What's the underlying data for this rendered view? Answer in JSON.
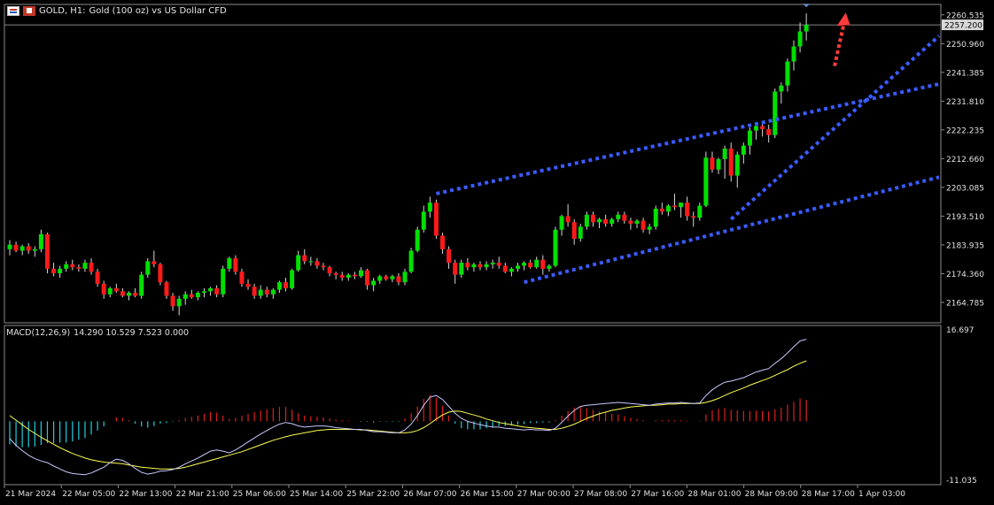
{
  "header": {
    "symbol_label": "GOLD, H1:",
    "description": "Gold (100 oz) vs US Dollar CFD",
    "icons": [
      "chart-grid-icon",
      "flag-icon"
    ]
  },
  "macd": {
    "label": "MACD(12,26,9)",
    "values_text": "14.290 10.529 7.523 0.000",
    "axis_top": "16.697",
    "axis_bottom": "-11.035"
  },
  "colors": {
    "background": "#000000",
    "bull": "#00e000",
    "bear": "#ff1a1a",
    "trend": "#3b5bff",
    "arrow": "#ff3b3b",
    "macd_line": "#c8c8ff",
    "signal_line": "#ffff55",
    "hist_pos": "#e02020",
    "hist_neg": "#20d0e0",
    "price_tag_bg": "#d8d8d8"
  },
  "chart_data": [
    {
      "type": "candlestick",
      "title": "GOLD, H1: Gold (100 oz) vs US Dollar CFD",
      "ylim": [
        2158,
        2264
      ],
      "y_ticks": [
        "2260.535",
        "2250.960",
        "2241.385",
        "2231.810",
        "2222.235",
        "2212.660",
        "2203.085",
        "2193.510",
        "2183.935",
        "2174.360",
        "2164.785"
      ],
      "current_price": "2257.200",
      "x_ticks": [
        "21 Mar 2024",
        "22 Mar 05:00",
        "22 Mar 13:00",
        "22 Mar 21:00",
        "25 Mar 06:00",
        "25 Mar 14:00",
        "25 Mar 22:00",
        "26 Mar 07:00",
        "26 Mar 15:00",
        "27 Mar 00:00",
        "27 Mar 08:00",
        "27 Mar 16:00",
        "28 Mar 01:00",
        "28 Mar 09:00",
        "28 Mar 17:00",
        "1 Apr 03:00"
      ],
      "candles": [
        [
          2182.5,
          2185.5,
          2180.5,
          2184.0
        ],
        [
          2184.0,
          2185.0,
          2181.5,
          2182.0
        ],
        [
          2182.0,
          2184.0,
          2180.5,
          2183.5
        ],
        [
          2183.5,
          2184.5,
          2181.0,
          2182.0
        ],
        [
          2182.0,
          2183.5,
          2180.0,
          2182.5
        ],
        [
          2182.5,
          2189.0,
          2181.5,
          2187.5
        ],
        [
          2187.5,
          2188.0,
          2174.5,
          2176.0
        ],
        [
          2176.0,
          2178.0,
          2173.5,
          2174.5
        ],
        [
          2174.5,
          2177.0,
          2173.0,
          2176.0
        ],
        [
          2176.0,
          2178.5,
          2175.0,
          2177.5
        ],
        [
          2177.5,
          2179.0,
          2175.5,
          2176.5
        ],
        [
          2176.5,
          2177.5,
          2175.0,
          2176.0
        ],
        [
          2176.0,
          2179.0,
          2175.0,
          2178.0
        ],
        [
          2178.0,
          2179.5,
          2174.0,
          2175.0
        ],
        [
          2175.0,
          2176.0,
          2170.0,
          2171.0
        ],
        [
          2171.0,
          2172.0,
          2166.0,
          2167.5
        ],
        [
          2167.5,
          2170.0,
          2166.5,
          2169.5
        ],
        [
          2169.5,
          2171.0,
          2168.0,
          2168.5
        ],
        [
          2168.5,
          2169.5,
          2166.5,
          2167.0
        ],
        [
          2167.0,
          2168.5,
          2165.5,
          2168.0
        ],
        [
          2168.0,
          2169.5,
          2166.5,
          2167.0
        ],
        [
          2167.0,
          2175.0,
          2166.0,
          2174.0
        ],
        [
          2174.0,
          2179.5,
          2173.0,
          2178.5
        ],
        [
          2178.5,
          2182.0,
          2176.5,
          2177.5
        ],
        [
          2177.5,
          2178.0,
          2170.5,
          2171.5
        ],
        [
          2171.5,
          2172.0,
          2166.0,
          2167.0
        ],
        [
          2167.0,
          2168.0,
          2162.0,
          2163.5
        ],
        [
          2163.5,
          2167.0,
          2160.5,
          2166.0
        ],
        [
          2166.0,
          2168.5,
          2164.0,
          2167.5
        ],
        [
          2167.5,
          2169.0,
          2166.0,
          2166.5
        ],
        [
          2166.5,
          2168.5,
          2165.5,
          2168.0
        ],
        [
          2168.0,
          2169.5,
          2166.5,
          2168.5
        ],
        [
          2168.5,
          2170.0,
          2167.0,
          2169.5
        ],
        [
          2169.5,
          2170.5,
          2166.5,
          2167.5
        ],
        [
          2167.5,
          2177.0,
          2166.5,
          2176.0
        ],
        [
          2176.0,
          2180.0,
          2175.0,
          2179.5
        ],
        [
          2179.5,
          2180.5,
          2174.0,
          2175.0
        ],
        [
          2175.0,
          2176.0,
          2170.0,
          2171.0
        ],
        [
          2171.0,
          2172.5,
          2169.0,
          2170.0
        ],
        [
          2170.0,
          2171.0,
          2166.0,
          2167.0
        ],
        [
          2167.0,
          2170.5,
          2166.0,
          2169.0
        ],
        [
          2169.0,
          2170.0,
          2166.5,
          2167.5
        ],
        [
          2167.5,
          2169.5,
          2166.0,
          2169.0
        ],
        [
          2169.0,
          2172.0,
          2168.0,
          2171.5
        ],
        [
          2171.5,
          2173.0,
          2168.5,
          2169.5
        ],
        [
          2169.5,
          2176.0,
          2169.0,
          2175.5
        ],
        [
          2175.5,
          2182.0,
          2175.0,
          2180.5
        ],
        [
          2180.5,
          2182.5,
          2177.5,
          2178.5
        ],
        [
          2178.5,
          2180.0,
          2177.0,
          2178.5
        ],
        [
          2178.5,
          2179.5,
          2176.0,
          2177.0
        ],
        [
          2177.0,
          2178.0,
          2175.5,
          2176.5
        ],
        [
          2176.5,
          2177.0,
          2173.5,
          2174.5
        ],
        [
          2174.5,
          2175.0,
          2172.5,
          2174.0
        ],
        [
          2174.0,
          2175.0,
          2172.0,
          2173.0
        ],
        [
          2173.0,
          2174.5,
          2172.0,
          2174.0
        ],
        [
          2174.0,
          2175.0,
          2172.5,
          2173.5
        ],
        [
          2173.5,
          2176.5,
          2173.0,
          2175.5
        ],
        [
          2175.5,
          2176.0,
          2169.0,
          2170.5
        ],
        [
          2170.5,
          2173.0,
          2168.5,
          2172.0
        ],
        [
          2172.0,
          2174.0,
          2171.0,
          2173.5
        ],
        [
          2173.5,
          2174.0,
          2172.0,
          2172.5
        ],
        [
          2172.5,
          2174.0,
          2171.5,
          2173.5
        ],
        [
          2173.5,
          2174.5,
          2170.5,
          2171.5
        ],
        [
          2171.5,
          2176.0,
          2170.5,
          2175.0
        ],
        [
          2175.0,
          2183.0,
          2174.5,
          2182.0
        ],
        [
          2182.0,
          2190.0,
          2181.5,
          2189.0
        ],
        [
          2189.0,
          2197.0,
          2188.0,
          2195.0
        ],
        [
          2195.0,
          2200.0,
          2193.0,
          2198.0
        ],
        [
          2198.0,
          2199.0,
          2186.0,
          2187.0
        ],
        [
          2187.0,
          2188.0,
          2181.0,
          2182.5
        ],
        [
          2182.5,
          2183.5,
          2176.0,
          2178.0
        ],
        [
          2178.0,
          2179.0,
          2171.0,
          2174.0
        ],
        [
          2174.0,
          2179.0,
          2173.0,
          2178.0
        ],
        [
          2178.0,
          2179.5,
          2175.5,
          2176.5
        ],
        [
          2176.5,
          2178.0,
          2175.0,
          2177.5
        ],
        [
          2177.5,
          2178.5,
          2175.5,
          2176.5
        ],
        [
          2176.5,
          2178.5,
          2175.5,
          2177.5
        ],
        [
          2177.5,
          2179.0,
          2176.0,
          2178.0
        ],
        [
          2178.0,
          2180.0,
          2176.0,
          2177.0
        ],
        [
          2177.0,
          2178.0,
          2174.5,
          2175.0
        ],
        [
          2175.0,
          2176.5,
          2173.5,
          2176.0
        ],
        [
          2176.0,
          2178.0,
          2175.0,
          2177.0
        ],
        [
          2177.0,
          2178.5,
          2175.5,
          2178.0
        ],
        [
          2178.0,
          2179.0,
          2176.0,
          2176.5
        ],
        [
          2176.5,
          2180.0,
          2176.0,
          2179.0
        ],
        [
          2179.0,
          2180.5,
          2174.0,
          2176.0
        ],
        [
          2176.0,
          2177.5,
          2175.0,
          2177.0
        ],
        [
          2177.0,
          2190.0,
          2176.5,
          2189.0
        ],
        [
          2189.0,
          2194.0,
          2187.0,
          2193.5
        ],
        [
          2193.5,
          2197.5,
          2190.0,
          2191.5
        ],
        [
          2191.5,
          2192.5,
          2184.0,
          2186.0
        ],
        [
          2186.0,
          2191.0,
          2185.0,
          2190.0
        ],
        [
          2190.0,
          2195.0,
          2189.0,
          2194.0
        ],
        [
          2194.0,
          2195.0,
          2190.0,
          2191.5
        ],
        [
          2191.5,
          2193.0,
          2189.5,
          2192.5
        ],
        [
          2192.5,
          2194.0,
          2190.0,
          2191.0
        ],
        [
          2191.0,
          2193.0,
          2190.0,
          2192.5
        ],
        [
          2192.5,
          2195.0,
          2191.5,
          2194.0
        ],
        [
          2194.0,
          2195.0,
          2191.0,
          2192.0
        ],
        [
          2192.0,
          2193.0,
          2189.0,
          2191.0
        ],
        [
          2191.0,
          2192.5,
          2189.5,
          2192.0
        ],
        [
          2192.0,
          2193.0,
          2188.0,
          2189.0
        ],
        [
          2189.0,
          2191.0,
          2187.5,
          2190.0
        ],
        [
          2190.0,
          2197.0,
          2189.0,
          2196.0
        ],
        [
          2196.0,
          2198.0,
          2194.0,
          2195.0
        ],
        [
          2195.0,
          2197.5,
          2193.5,
          2197.0
        ],
        [
          2197.0,
          2201.0,
          2195.5,
          2196.5
        ],
        [
          2196.5,
          2198.0,
          2193.0,
          2198.0
        ],
        [
          2198.0,
          2200.0,
          2192.0,
          2193.5
        ],
        [
          2193.5,
          2195.0,
          2190.0,
          2193.0
        ],
        [
          2193.0,
          2198.0,
          2192.0,
          2197.0
        ],
        [
          2197.0,
          2215.0,
          2196.5,
          2213.0
        ],
        [
          2213.0,
          2215.0,
          2208.0,
          2209.0
        ],
        [
          2209.0,
          2213.0,
          2207.5,
          2212.5
        ],
        [
          2212.5,
          2217.0,
          2206.0,
          2216.0
        ],
        [
          2216.0,
          2218.0,
          2205.0,
          2207.0
        ],
        [
          2207.0,
          2215.0,
          2203.0,
          2214.0
        ],
        [
          2214.0,
          2218.0,
          2211.0,
          2217.0
        ],
        [
          2217.0,
          2223.0,
          2214.0,
          2222.0
        ],
        [
          2222.0,
          2224.0,
          2219.0,
          2223.5
        ],
        [
          2223.5,
          2225.0,
          2220.0,
          2222.5
        ],
        [
          2222.5,
          2224.0,
          2218.0,
          2220.5
        ],
        [
          2220.5,
          2236.0,
          2219.5,
          2235.0
        ],
        [
          2235.0,
          2238.0,
          2231.0,
          2237.0
        ],
        [
          2237.0,
          2246.0,
          2235.0,
          2245.0
        ],
        [
          2245.0,
          2252.0,
          2242.0,
          2250.0
        ],
        [
          2250.0,
          2258.0,
          2248.0,
          2255.0
        ],
        [
          2255.0,
          2261.0,
          2252.0,
          2257.2
        ]
      ],
      "trend_lines": [
        {
          "name": "channel-upper",
          "from": [
            68,
            2201.0
          ],
          "to": [
            "edge",
            2237.5
          ]
        },
        {
          "name": "channel-lower",
          "from": [
            82,
            2171.5
          ],
          "to": [
            "edge",
            2206.5
          ]
        },
        {
          "name": "steep-trend",
          "from": [
            115,
            2192.5
          ],
          "to": [
            "edge",
            2253.5
          ]
        }
      ],
      "arrow": {
        "from": [
          131.5,
          2243.5
        ],
        "to": [
          133,
          2259.5
        ]
      }
    },
    {
      "type": "bar+line",
      "title": "MACD(12,26,9)",
      "ylim": [
        -11.035,
        16.697
      ],
      "macd": [
        -3.0,
        -4.2,
        -5.1,
        -5.9,
        -6.5,
        -6.9,
        -7.2,
        -7.8,
        -8.3,
        -8.8,
        -9.1,
        -9.2,
        -9.3,
        -9.0,
        -8.5,
        -8.0,
        -7.2,
        -6.6,
        -6.8,
        -7.4,
        -8.2,
        -8.9,
        -9.2,
        -9.0,
        -8.7,
        -8.6,
        -8.4,
        -8.0,
        -7.4,
        -6.9,
        -6.4,
        -5.8,
        -5.2,
        -5.0,
        -5.2,
        -5.5,
        -5.0,
        -4.3,
        -3.6,
        -2.9,
        -2.2,
        -1.6,
        -1.0,
        -0.5,
        -0.2,
        -0.4,
        -0.8,
        -1.0,
        -0.9,
        -0.8,
        -0.8,
        -0.9,
        -1.1,
        -1.2,
        -1.3,
        -1.4,
        -1.4,
        -1.6,
        -1.8,
        -1.8,
        -1.9,
        -2.0,
        -2.0,
        -1.5,
        -0.5,
        1.0,
        2.8,
        4.2,
        4.5,
        3.8,
        2.6,
        1.4,
        0.5,
        0.0,
        -0.3,
        -0.6,
        -0.8,
        -1.0,
        -1.0,
        -1.2,
        -1.3,
        -1.4,
        -1.5,
        -1.4,
        -1.5,
        -1.5,
        -1.6,
        -1.2,
        -0.2,
        0.9,
        1.9,
        2.6,
        2.8,
        2.9,
        3.0,
        3.1,
        3.2,
        3.3,
        3.2,
        3.1,
        3.0,
        2.9,
        2.8,
        3.0,
        3.1,
        3.2,
        3.2,
        3.3,
        3.2,
        3.1,
        3.2,
        4.5,
        5.5,
        6.2,
        6.8,
        7.0,
        7.3,
        7.6,
        8.1,
        8.6,
        8.9,
        9.2,
        10.1,
        10.9,
        11.9,
        13.0,
        14.0,
        14.29
      ],
      "signal": [
        1.0,
        0.2,
        -0.6,
        -1.4,
        -2.1,
        -2.8,
        -3.4,
        -4.0,
        -4.6,
        -5.1,
        -5.6,
        -6.0,
        -6.4,
        -6.7,
        -6.9,
        -7.1,
        -7.2,
        -7.3,
        -7.4,
        -7.6,
        -7.8,
        -8.0,
        -8.1,
        -8.2,
        -8.3,
        -8.3,
        -8.3,
        -8.2,
        -8.0,
        -7.7,
        -7.4,
        -7.1,
        -6.8,
        -6.5,
        -6.2,
        -5.9,
        -5.6,
        -5.3,
        -4.9,
        -4.5,
        -4.1,
        -3.7,
        -3.3,
        -3.0,
        -2.7,
        -2.4,
        -2.2,
        -2.0,
        -1.8,
        -1.6,
        -1.5,
        -1.4,
        -1.4,
        -1.4,
        -1.4,
        -1.4,
        -1.5,
        -1.5,
        -1.6,
        -1.7,
        -1.8,
        -1.9,
        -2.0,
        -2.0,
        -1.9,
        -1.6,
        -1.1,
        -0.4,
        0.4,
        1.1,
        1.6,
        1.8,
        1.7,
        1.4,
        1.1,
        0.8,
        0.4,
        0.1,
        -0.2,
        -0.4,
        -0.6,
        -0.8,
        -1.0,
        -1.1,
        -1.2,
        -1.3,
        -1.4,
        -1.4,
        -1.2,
        -0.9,
        -0.5,
        0.0,
        0.5,
        0.9,
        1.3,
        1.6,
        1.9,
        2.1,
        2.3,
        2.5,
        2.6,
        2.7,
        2.8,
        2.8,
        2.9,
        3.0,
        3.0,
        3.1,
        3.1,
        3.1,
        3.1,
        3.3,
        3.6,
        4.0,
        4.5,
        5.0,
        5.4,
        5.8,
        6.3,
        6.7,
        7.1,
        7.5,
        8.0,
        8.5,
        9.0,
        9.6,
        10.1,
        10.529
      ],
      "histogram": [
        -4.0,
        -4.4,
        -4.5,
        -4.5,
        -4.4,
        -4.1,
        -3.8,
        -3.8,
        -3.7,
        -3.7,
        -3.5,
        -3.2,
        -2.9,
        -2.3,
        -1.6,
        -0.9,
        0.0,
        0.7,
        0.6,
        0.2,
        -0.4,
        -0.9,
        -1.1,
        -0.8,
        -0.4,
        -0.3,
        -0.1,
        0.2,
        0.6,
        0.8,
        1.0,
        1.3,
        1.6,
        1.5,
        1.0,
        0.4,
        0.6,
        1.0,
        1.3,
        1.6,
        1.9,
        2.1,
        2.3,
        2.5,
        2.5,
        2.0,
        1.4,
        1.0,
        0.9,
        0.8,
        0.7,
        0.5,
        0.3,
        0.2,
        0.1,
        0.0,
        -0.1,
        -0.1,
        -0.2,
        -0.1,
        -0.1,
        -0.1,
        -0.1,
        0.5,
        1.4,
        2.6,
        3.9,
        4.6,
        4.1,
        2.7,
        1.0,
        -0.4,
        -1.2,
        -1.4,
        -1.4,
        -1.4,
        -1.2,
        -1.1,
        -0.8,
        -0.8,
        -0.7,
        -0.6,
        -0.5,
        -0.3,
        -0.3,
        -0.2,
        -0.2,
        0.2,
        1.0,
        1.8,
        2.4,
        2.6,
        2.3,
        2.0,
        1.7,
        1.5,
        1.3,
        1.2,
        0.9,
        0.6,
        0.4,
        0.2,
        0.0,
        0.2,
        0.2,
        0.2,
        0.2,
        0.2,
        0.1,
        0.0,
        0.1,
        1.2,
        1.9,
        2.2,
        2.3,
        2.0,
        1.9,
        1.8,
        1.8,
        1.9,
        1.8,
        1.7,
        2.1,
        2.4,
        2.9,
        3.4,
        4.0,
        3.76
      ]
    }
  ]
}
